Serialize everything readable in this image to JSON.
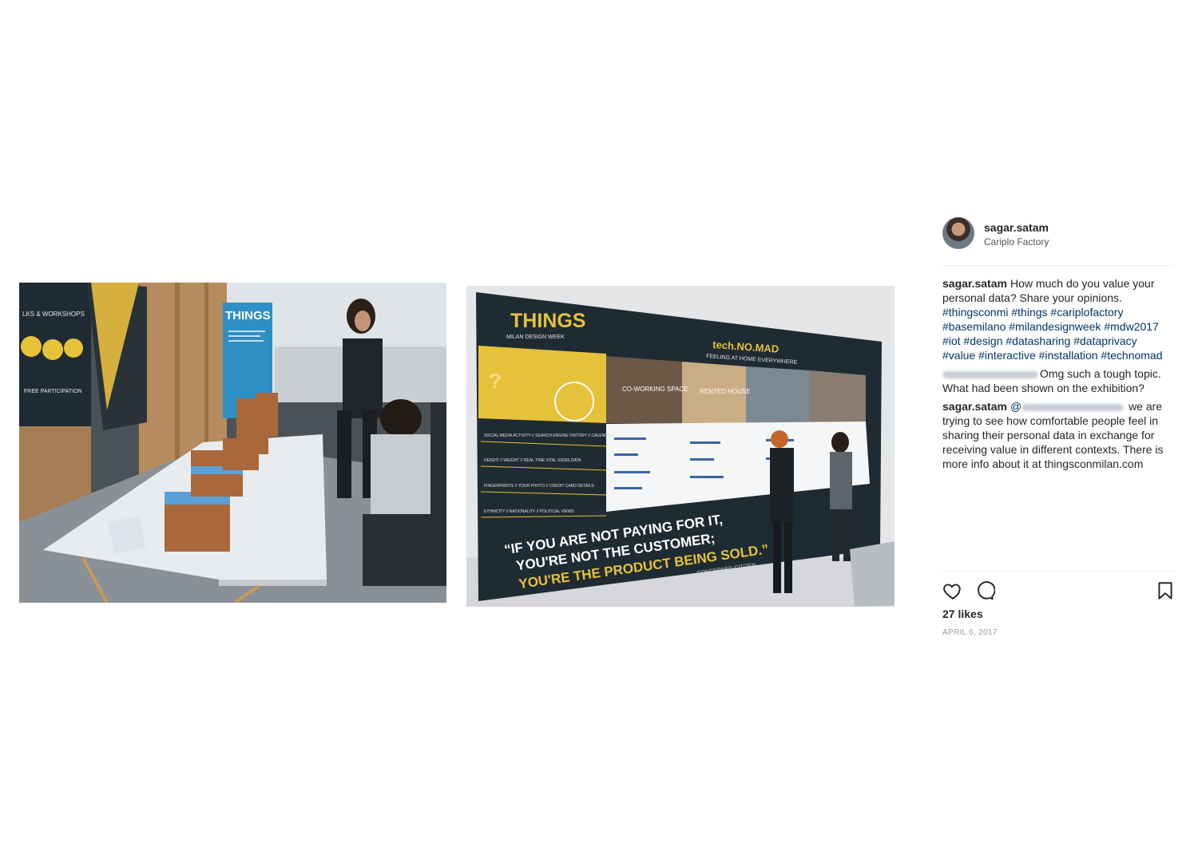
{
  "post": {
    "username": "sagar.satam",
    "location": "Cariplo Factory",
    "caption_user": "sagar.satam",
    "caption_text": "How much do you value your personal data? Share your opinions.",
    "hashtags": "#thingsconmi #things #cariplofactory #basemilano #milandesignweek #mdw2017 #iot #design #datasharing #dataprivacy #value #interactive #installation #technomad",
    "comment1_text": "Omg such a tough topic. What had been shown on the exhibition?",
    "reply_user": "sagar.satam",
    "reply_mention_prefix": "@",
    "reply_text": "we are trying to see how comfortable people feel in sharing their personal data in exchange for receiving value in different contexts. There is more info about it at thingsconmilan.com",
    "likes": "27 likes",
    "date": "APRIL 6, 2017"
  },
  "photo1": {
    "banner_title": "THINGS",
    "poster_text_1": "LKS & WORKSHOPS",
    "poster_text_2": "FREE PARTICIPATION"
  },
  "photo2": {
    "logo": "THINGS",
    "logo_sub": "MILAN DESIGN WEEK",
    "headline": "tech.NO.MAD",
    "tagline": "FEELING AT HOME EVERYWHERE",
    "context_1": "CO-WORKING SPACE",
    "context_2": "RENTED HOUSE",
    "quote_line1": "“IF YOU ARE NOT PAYING FOR IT,",
    "quote_line2": "YOU'RE NOT THE CUSTOMER;",
    "quote_line3": "YOU'RE THE PRODUCT BEING SOLD.”",
    "quote_author": "CONCERNED CITIZEN",
    "data_row_1": "SOCIAL MEDIA ACTIVITY // SEARCH ENGINE HISTORY // CALENDAR",
    "data_row_2": "HEIGHT // WEIGHT // REAL TIME VITAL SIGNS DATA",
    "data_row_3": "FINGERPRINTS // YOUR PHOTO // CREDIT CARD DETAILS",
    "data_row_4": "ETHNICITY // NATIONALITY // POLITICAL VIEWS"
  },
  "colors": {
    "accent_yellow": "#e6c23a",
    "dark_poster": "#1f2b33",
    "link": "#003569"
  },
  "icons": [
    "heart-icon",
    "comment-icon",
    "bookmark-icon"
  ]
}
